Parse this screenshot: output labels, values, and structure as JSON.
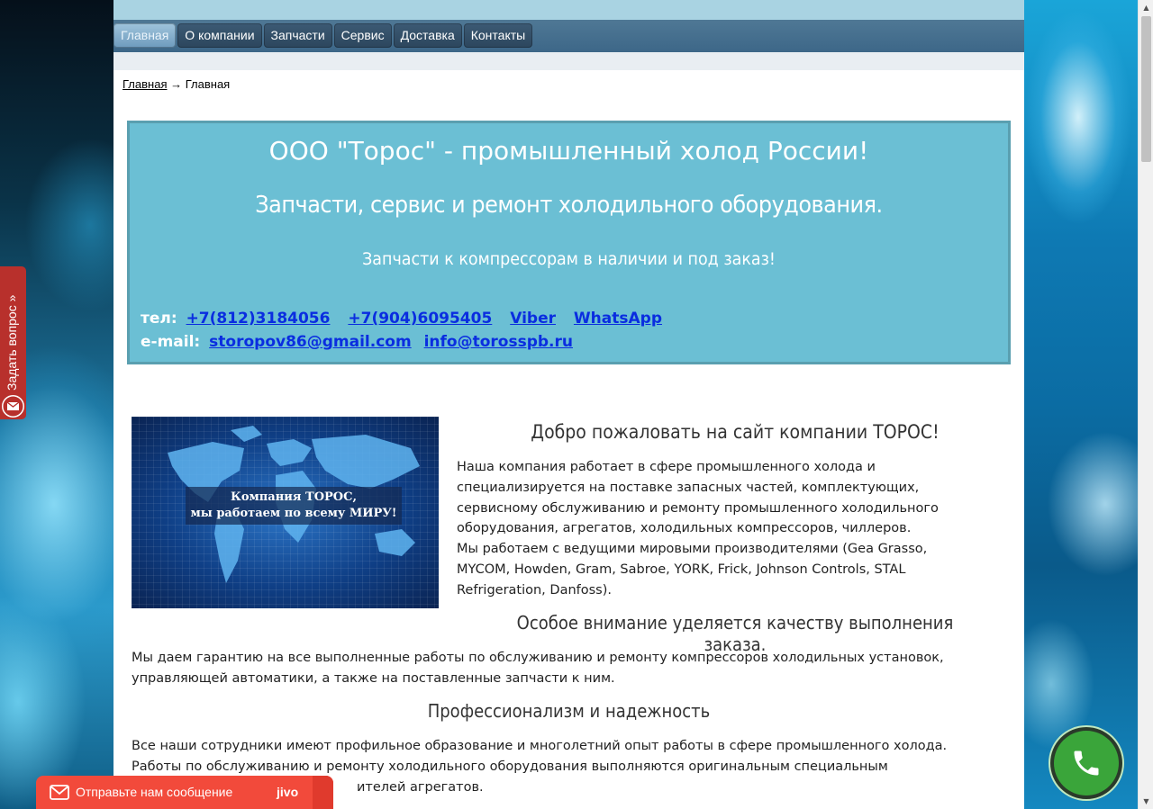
{
  "navigation": {
    "items": [
      "Главная",
      "О компании",
      "Запчасти",
      "Сервис",
      "Доставка",
      "Контакты"
    ],
    "active": "Главная"
  },
  "breadcrumb": {
    "link": "Главная",
    "separator": "→",
    "current": "Главная"
  },
  "banner": {
    "title": "ООО \"Торос\" - промышленный холод России!",
    "subtitle": "Запчасти, сервис и ремонт холодильного оборудования.",
    "tagline": "Запчасти к компрессорам в наличии и под заказ!",
    "phone_label": "тел:",
    "phones": [
      "+7(812)3184056",
      "+7(904)6095405"
    ],
    "messengers": [
      "Viber",
      "WhatsApp"
    ],
    "email_label": "e-mail:",
    "emails": [
      "storopov86@gmail.com",
      "info@torosspb.ru"
    ]
  },
  "image": {
    "caption_line1": "Компания ТОРОС,",
    "caption_line2": "мы работаем по всему МИРУ!"
  },
  "article": {
    "welcome_heading": "Добро пожаловать на сайт компании ТОРОС!",
    "welcome_text_1": " Наша компания работает в сфере промышленного холода и специализируется на поставке запасных частей, комплектующих, сервисному обслуживанию и ремонту промышленного холодильного оборудования, агрегатов, холодильных компрессоров, чиллеров.",
    "welcome_text_2": " Мы работаем с ведущими мировыми производителями (Gea Grasso, MYCOM, Howden, Gram, Sabroe, YORK, Frick, Johnson Controls, STAL Refrigeration, Danfoss).",
    "quality_heading": "Особое внимание уделяется качеству выполнения заказа.",
    "quality_text": " Мы даем гарантию на все выполненные работы по обслуживанию и ремонту компрессоров холодильных установок, управляющей автоматики, а также на поставленные запчасти к ним.",
    "prof_heading": "Профессионализм и надежность",
    "prof_text_1": " Все наши сотрудники имеют профильное образование и многолетний опыт работы в сфере промышленного холода.",
    "prof_text_2": " Работы по обслуживанию и ремонту холодильного оборудования выполняются оригинальным специальным",
    "prof_text_3": "ителей агрегатов."
  },
  "widgets": {
    "ask_question": "Задать вопрос",
    "ask_arrow": "»",
    "chat_label": "Отправьте нам сообщение",
    "chat_brand": "jivo"
  },
  "colors": {
    "nav_bar": "#3d6788",
    "banner_bg": "#6bbfd4",
    "link": "#0a2de0",
    "ask_tab": "#b8302c",
    "chat": "#f24a3b",
    "call_button": "#3aa53a"
  },
  "icons": {
    "ask_icon": "envelope-icon",
    "chat_icon": "envelope-icon",
    "call_icon": "phone-icon",
    "scroll_up": "arrow-up-icon",
    "scroll_down": "arrow-down-icon"
  }
}
